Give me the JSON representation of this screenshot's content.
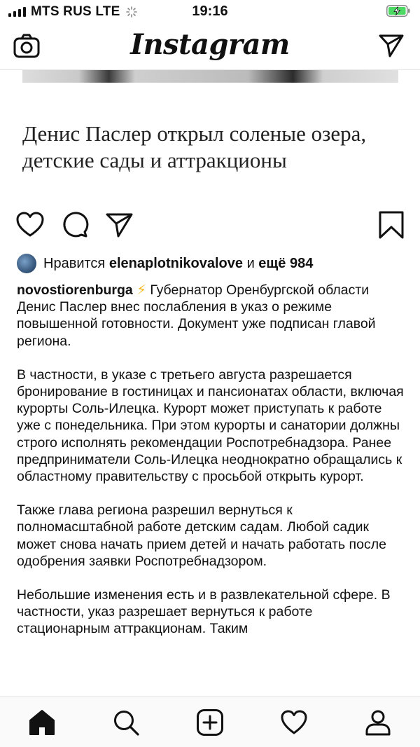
{
  "status_bar": {
    "carrier": "MTS RUS  LTE",
    "time": "19:16"
  },
  "header": {
    "logo": "Instagram",
    "left_icon": "camera-icon",
    "right_icon": "direct-send-icon"
  },
  "post": {
    "title": "Денис Паслер открыл соленые озера, детские сады и аттракционы",
    "likes": {
      "prefix": "Нравится",
      "user": "elenaplotnikovalove",
      "middle": "и",
      "rest": "ещё 984"
    },
    "caption": {
      "username": "novostiorenburga",
      "emoji": "⚡",
      "paragraphs": [
        "Губернатор Оренбургской области Денис Паслер внес послабления в указ о режиме повышенной готовности. Документ уже подписан главой региона.",
        "В частности, в указе с третьего августа разрешается бронирование в гостиницах и пансионатах области, включая курорты Соль-Илецка. Курорт может приступать к работе уже с понедельника. При этом курорты и санатории должны строго исполнять рекомендации Роспотребнадзора. Ранее предприниматели Соль-Илецка неоднократно обращались к областному правительству с просьбой открыть курорт.",
        "Также глава региона разрешил вернуться к полномасштабной работе детским садам. Любой садик может снова начать прием детей и начать работать после одобрения заявки Роспотребнадзором.",
        "Небольшие изменения есть и в развлекательной сфере. В частности, указ разрешает вернуться к работе стационарным аттракционам. Таким"
      ]
    }
  },
  "bottom_nav": [
    "home-icon",
    "search-icon",
    "new-post-icon",
    "activity-icon",
    "profile-icon"
  ]
}
